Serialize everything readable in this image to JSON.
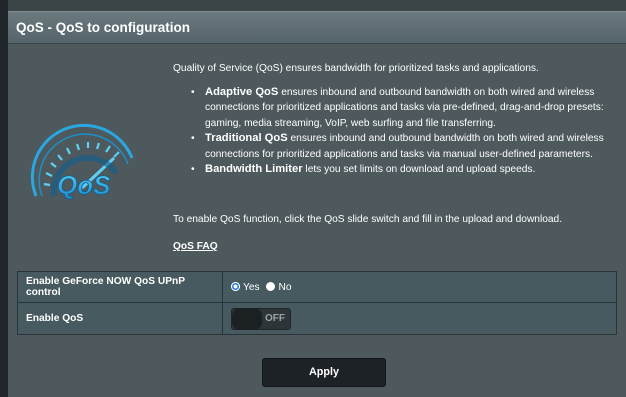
{
  "header": {
    "title": "QoS - QoS to configuration"
  },
  "logo": {
    "text": "QoS"
  },
  "intro": "Quality of Service (QoS) ensures bandwidth for prioritized tasks and applications.",
  "bullets": [
    {
      "bold": "Adaptive QoS",
      "text": " ensures inbound and outbound bandwidth on both wired and wireless connections for prioritized applications and tasks via pre-defined, drag-and-drop presets: gaming, media streaming, VoIP, web surfing and file transferring."
    },
    {
      "bold": "Traditional QoS",
      "text": " ensures inbound and outbound bandwidth on both wired and wireless connections for prioritized applications and tasks via manual user-defined parameters."
    },
    {
      "bold": "Bandwidth Limiter",
      "text": " lets you set limits on download and upload speeds."
    }
  ],
  "enable_note": "To enable QoS function, click the QoS slide switch and fill in the upload and download.",
  "faq_link": "QoS FAQ",
  "form": {
    "geforce_label": "Enable GeForce NOW QoS UPnP control",
    "geforce_yes": "Yes",
    "geforce_no": "No",
    "geforce_selected": "Yes",
    "enable_qos_label": "Enable QoS",
    "enable_qos_state": "OFF"
  },
  "apply_label": "Apply",
  "colors": {
    "accent": "#1d78d6",
    "logo_blue": "#2aa7e0",
    "background": "#4d595d"
  }
}
